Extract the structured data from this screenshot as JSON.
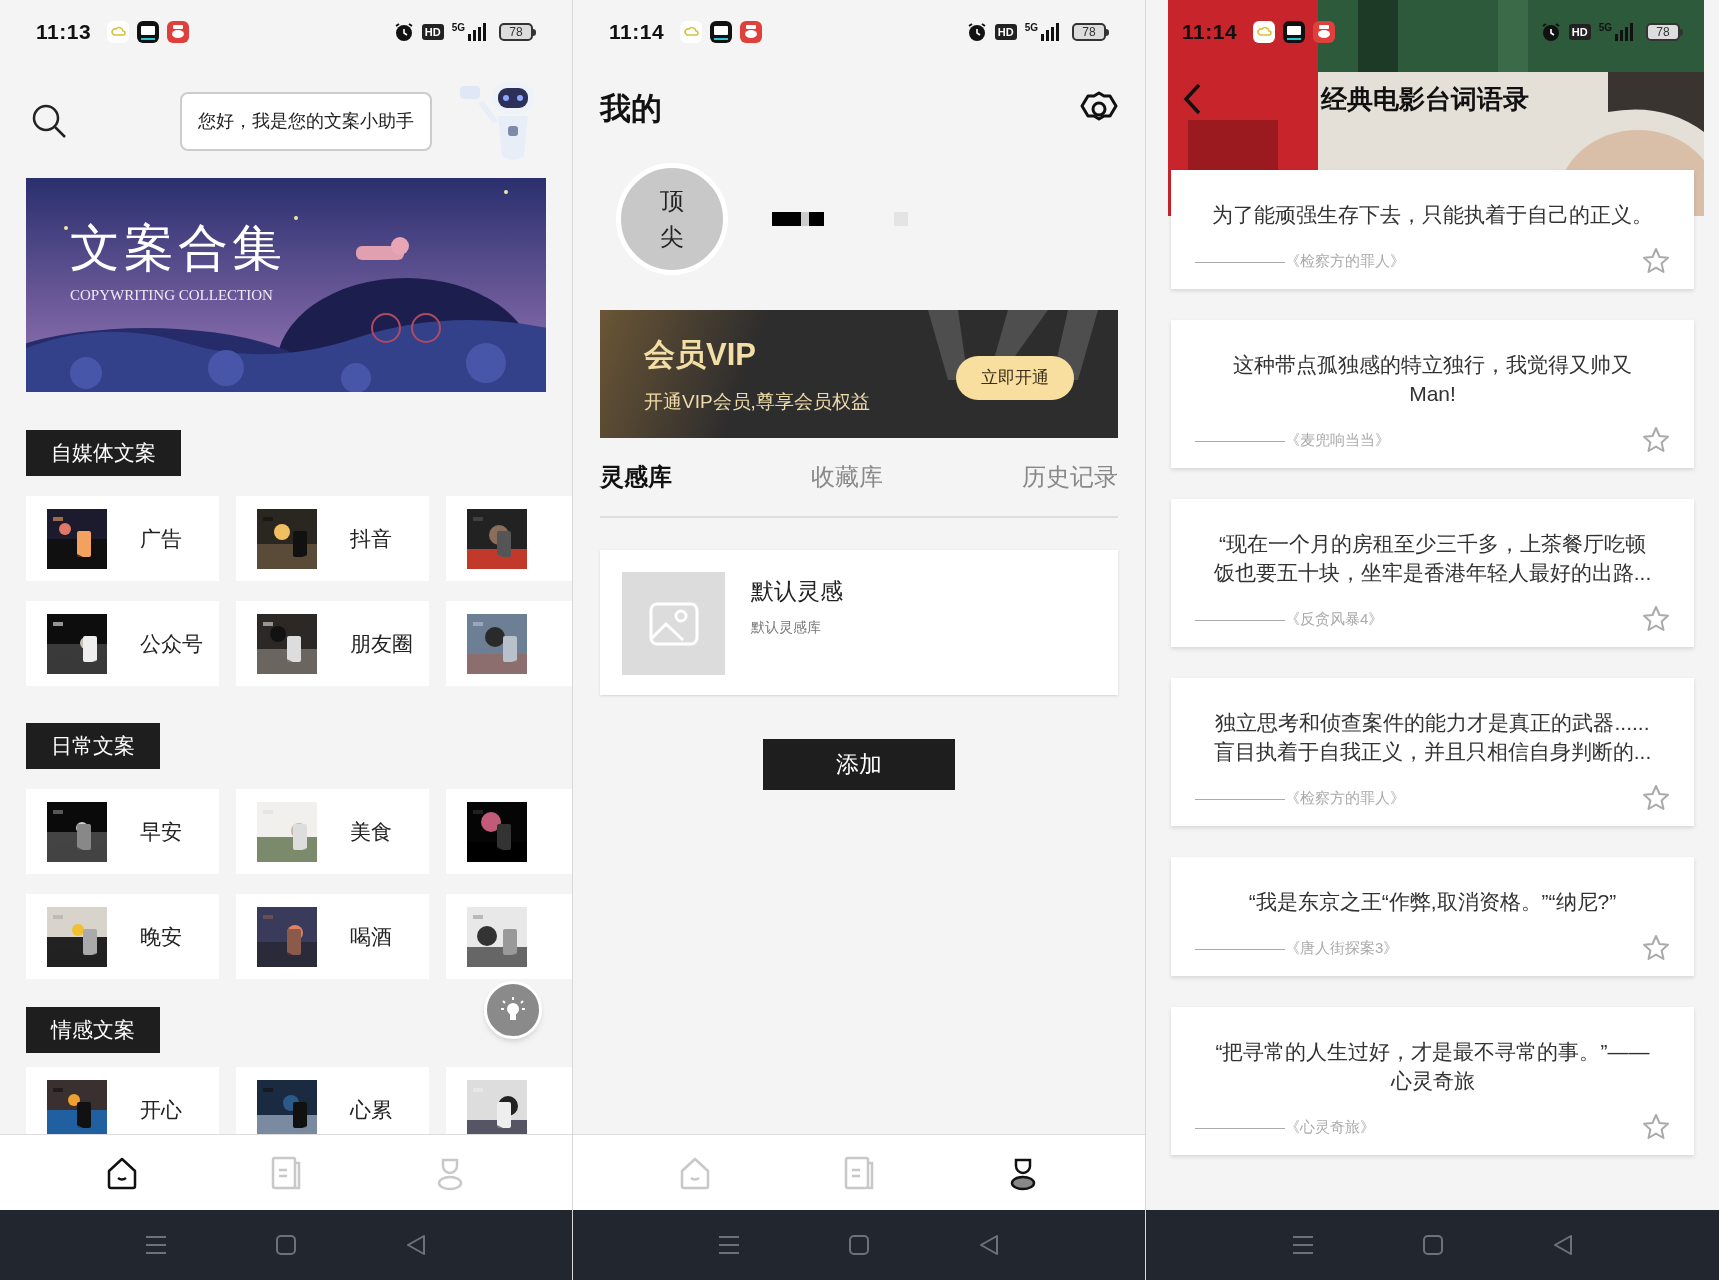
{
  "home_screen": {
    "status_bar": {
      "time": "11:13",
      "hd": "HD",
      "network": "5G",
      "battery": "78"
    },
    "assistant_bubble": "您好，我是您的文案小助手",
    "banner": {
      "title": "文案合集",
      "subtitle": "COPYWRITING COLLECTION"
    },
    "sections": [
      {
        "title": "自媒体文案",
        "rows": [
          [
            {
              "kind": "tile",
              "label": "广告"
            },
            {
              "kind": "tile",
              "label": "抖音"
            },
            {
              "kind": "tile_cut"
            }
          ],
          [
            {
              "kind": "tile",
              "label": "公众号"
            },
            {
              "kind": "tile",
              "label": "朋友圈"
            },
            {
              "kind": "tile_cut"
            }
          ]
        ]
      },
      {
        "title": "日常文案",
        "rows": [
          [
            {
              "kind": "tile",
              "label": "早安"
            },
            {
              "kind": "tile",
              "label": "美食"
            },
            {
              "kind": "tile_cut"
            }
          ],
          [
            {
              "kind": "tile",
              "label": "晚安"
            },
            {
              "kind": "tile",
              "label": "喝酒"
            },
            {
              "kind": "tile_cut"
            }
          ]
        ]
      },
      {
        "title": "情感文案",
        "rows": [
          [
            {
              "kind": "tile",
              "label": "开心"
            },
            {
              "kind": "tile",
              "label": "心累"
            },
            {
              "kind": "tile_cut"
            }
          ]
        ]
      }
    ],
    "bottom_nav": [
      {
        "kind": "home",
        "selected": true
      },
      {
        "kind": "notes",
        "selected": false
      },
      {
        "kind": "profile",
        "selected": false
      }
    ]
  },
  "profile_screen": {
    "status_bar": {
      "time": "11:14",
      "hd": "HD",
      "network": "5G",
      "battery": "78"
    },
    "title": "我的",
    "avatar": {
      "line_1": "顶",
      "line_2": "尖"
    },
    "vip": {
      "title": "会员VIP",
      "subtitle": "开通VIP会员,尊享会员权益",
      "button": "立即开通"
    },
    "tabs": [
      {
        "label": "灵感库",
        "selected": true
      },
      {
        "label": "收藏库",
        "selected": false
      },
      {
        "label": "历史记录",
        "selected": false
      }
    ],
    "collections": [
      {
        "title": "默认灵感",
        "subtitle": "默认灵感库"
      }
    ],
    "add_button": "添加",
    "bottom_nav": [
      {
        "kind": "home",
        "selected": false
      },
      {
        "kind": "notes",
        "selected": false
      },
      {
        "kind": "profile",
        "selected": true
      }
    ]
  },
  "quotes_screen": {
    "status_bar": {
      "time": "11:14",
      "hd": "HD",
      "network": "5G",
      "battery": "78"
    },
    "title": "经典电影台词语录",
    "quotes": [
      {
        "text": "为了能顽强生存下去，只能执着于自己的正义。",
        "source": "——————《检察方的罪人》",
        "starred": false
      },
      {
        "text": "这种带点孤独感的特立独行，我觉得又帅又Man!",
        "source": "——————《麦兜响当当》",
        "starred": false
      },
      {
        "text": "“现在一个月的房租至少三千多，上茶餐厅吃顿饭也要五十块，坐牢是香港年轻人最好的出路...",
        "source": "——————《反贪风暴4》",
        "starred": false
      },
      {
        "text": "独立思考和侦查案件的能力才是真正的武器......盲目执着于自我正义，并且只相信自身判断的...",
        "source": "——————《检察方的罪人》",
        "starred": false
      },
      {
        "text": "“我是东京之王“作弊,取消资格。”“纳尼?”",
        "source": "——————《唐人街探案3》",
        "starred": false
      },
      {
        "text": "“把寻常的人生过好，才是最不寻常的事。”——心灵奇旅",
        "source": "——————《心灵奇旅》",
        "starred": false
      }
    ]
  }
}
